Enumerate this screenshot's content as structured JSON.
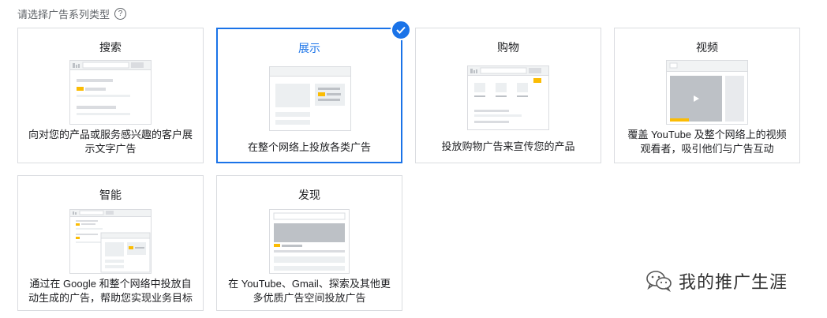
{
  "header": {
    "title": "请选择广告系列类型",
    "help_icon_glyph": "?"
  },
  "cards": [
    {
      "title": "搜索",
      "description": "向对您的产品或服务感兴趣的客户展示文字广告",
      "illustration": "search-ad-illustration"
    },
    {
      "title": "展示",
      "description": "在整个网络上投放各类广告",
      "illustration": "display-ad-illustration",
      "selected": true
    },
    {
      "title": "购物",
      "description": "投放购物广告来宣传您的产品",
      "illustration": "shopping-ad-illustration"
    },
    {
      "title": "视频",
      "description": "覆盖 YouTube 及整个网络上的视频观看者，吸引他们与广告互动",
      "illustration": "video-ad-illustration"
    },
    {
      "title": "智能",
      "description": "通过在 Google 和整个网络中投放自动生成的广告，帮助您实现业务目标",
      "illustration": "smart-ad-illustration"
    },
    {
      "title": "发现",
      "description": "在 YouTube、Gmail、探索及其他更多优质广告空间投放广告",
      "illustration": "discovery-ad-illustration"
    }
  ],
  "watermark": {
    "text": "我的推广生涯",
    "icon": "wechat-icon"
  },
  "colors": {
    "accent": "#1a73e8",
    "highlight": "#fbbc04",
    "border": "#dadce0"
  }
}
